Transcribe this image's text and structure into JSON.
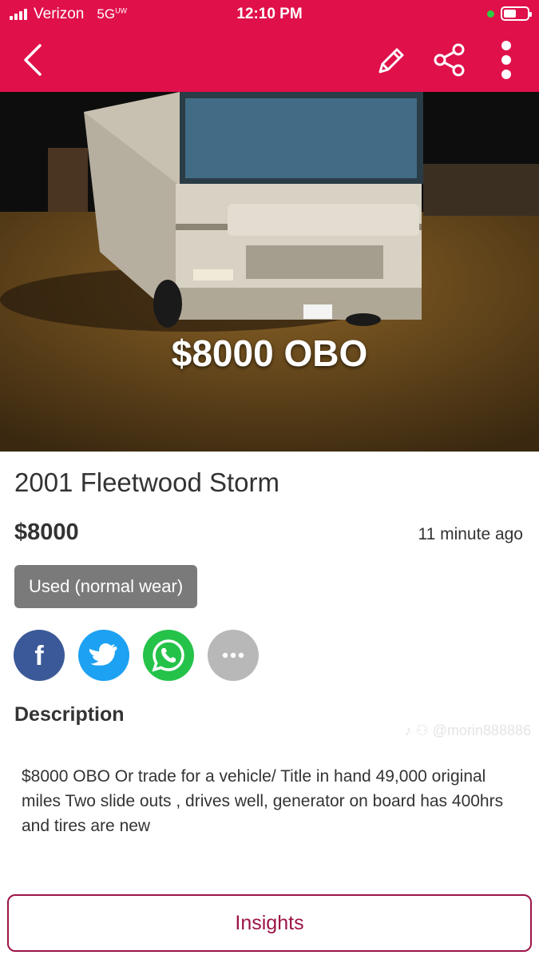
{
  "status_bar": {
    "carrier": "Verizon",
    "network": "5G",
    "network_sup": "UW",
    "time": "12:10 PM",
    "signal_bars": 4,
    "battery_level": 0.55
  },
  "app_bar": {
    "back_icon": "chevron-left-icon",
    "edit_icon": "pencil-icon",
    "share_icon": "share-icon",
    "more_icon": "more-vertical-icon"
  },
  "photo": {
    "overlay_text": "$8000 OBO"
  },
  "listing": {
    "title": "2001 Fleetwood Storm",
    "price": "$8000",
    "posted": "11 minute ago",
    "condition": "Used (normal wear)"
  },
  "share": {
    "icons": [
      "facebook-icon",
      "twitter-icon",
      "whatsapp-icon",
      "more-horizontal-icon"
    ]
  },
  "description": {
    "heading": "Description",
    "watermark": "@morin888886",
    "body": "$8000 OBO Or trade for a vehicle/ Title in hand 49,000 original miles Two slide outs , drives well, generator on board has 400hrs and tires are new"
  },
  "actions": {
    "insights_label": "Insights"
  },
  "colors": {
    "brand": "#e0104a",
    "insights_border": "#9c1448",
    "condition_badge": "#7a7a7a"
  }
}
